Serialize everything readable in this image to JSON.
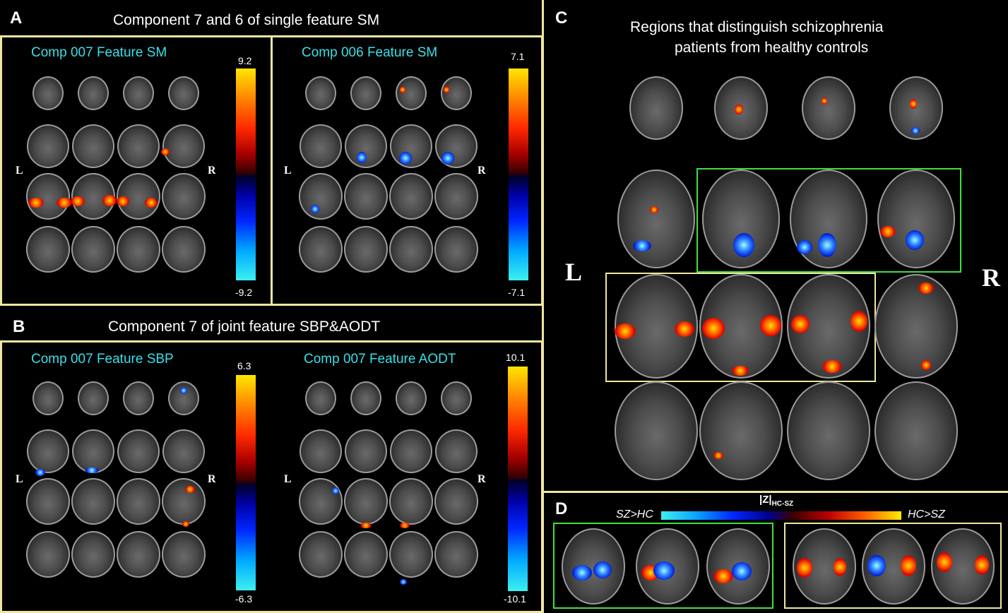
{
  "panel_a": {
    "letter": "A",
    "title": "Component 7 and 6 of single feature SM",
    "left": {
      "label": "Comp 007 Feature SM",
      "max": "9.2",
      "min": "-9.2"
    },
    "right": {
      "label": "Comp 006 Feature SM",
      "max": "7.1",
      "min": "-7.1"
    }
  },
  "panel_b": {
    "letter": "B",
    "title": "Component 7 of joint feature SBP&AODT",
    "left": {
      "label": "Comp 007 Feature SBP",
      "max": "6.3",
      "min": "-6.3"
    },
    "right": {
      "label": "Comp 007 Feature AODT",
      "max": "10.1",
      "min": "-10.1"
    }
  },
  "panel_c": {
    "letter": "C",
    "title_line1": "Regions that distinguish schizophrenia",
    "title_line2": "patients from healthy controls"
  },
  "panel_d": {
    "letter": "D",
    "scale_label": "|Z|",
    "scale_sub": "HC-SZ",
    "left_label": "SZ>HC",
    "right_label": "HC>SZ"
  },
  "side_labels": {
    "left": "L",
    "right": "R"
  },
  "colors": {
    "frame": "#efe6a0",
    "cyan_text": "#39e0e8",
    "green_box": "#3fe040"
  }
}
